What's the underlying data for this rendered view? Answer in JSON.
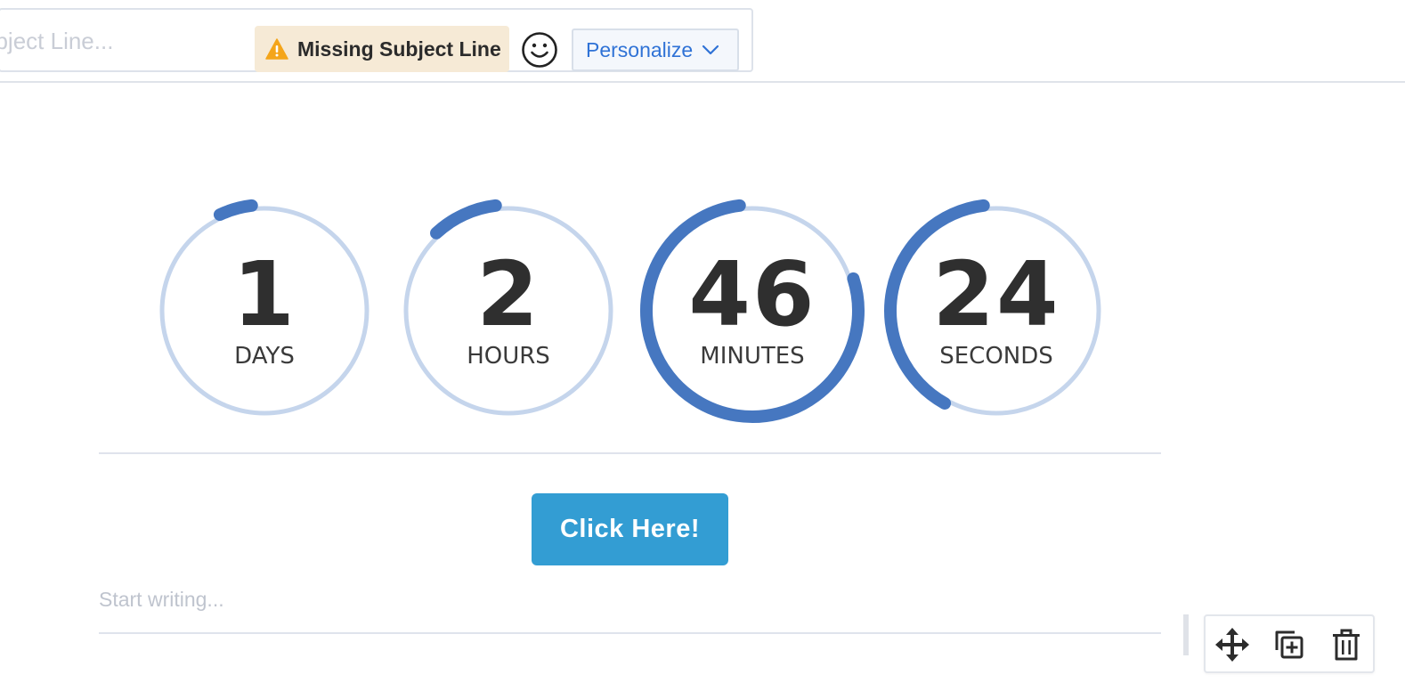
{
  "subject": {
    "placeholder": "ubject Line...",
    "warning_text": "Missing Subject Line",
    "warning_icon": "warning-triangle-icon",
    "emoji_icon": "smiley-icon",
    "personalize_label": "Personalize",
    "personalize_icon": "chevron-down-icon"
  },
  "countdown": {
    "ring_color": "#4677c0",
    "track_color": "#c5d5ec",
    "units": [
      {
        "value": "1",
        "label": "DAYS",
        "progress": 0.05
      },
      {
        "value": "2",
        "label": "HOURS",
        "progress": 0.1
      },
      {
        "value": "46",
        "label": "MINUTES",
        "progress": 0.78
      },
      {
        "value": "24",
        "label": "SECONDS",
        "progress": 0.4
      }
    ]
  },
  "cta": {
    "label": "Click Here!",
    "color": "#339dd3"
  },
  "editor": {
    "placeholder": "Start writing..."
  },
  "block_toolbar": {
    "icons": [
      "move-icon",
      "duplicate-icon",
      "trash-icon"
    ]
  }
}
